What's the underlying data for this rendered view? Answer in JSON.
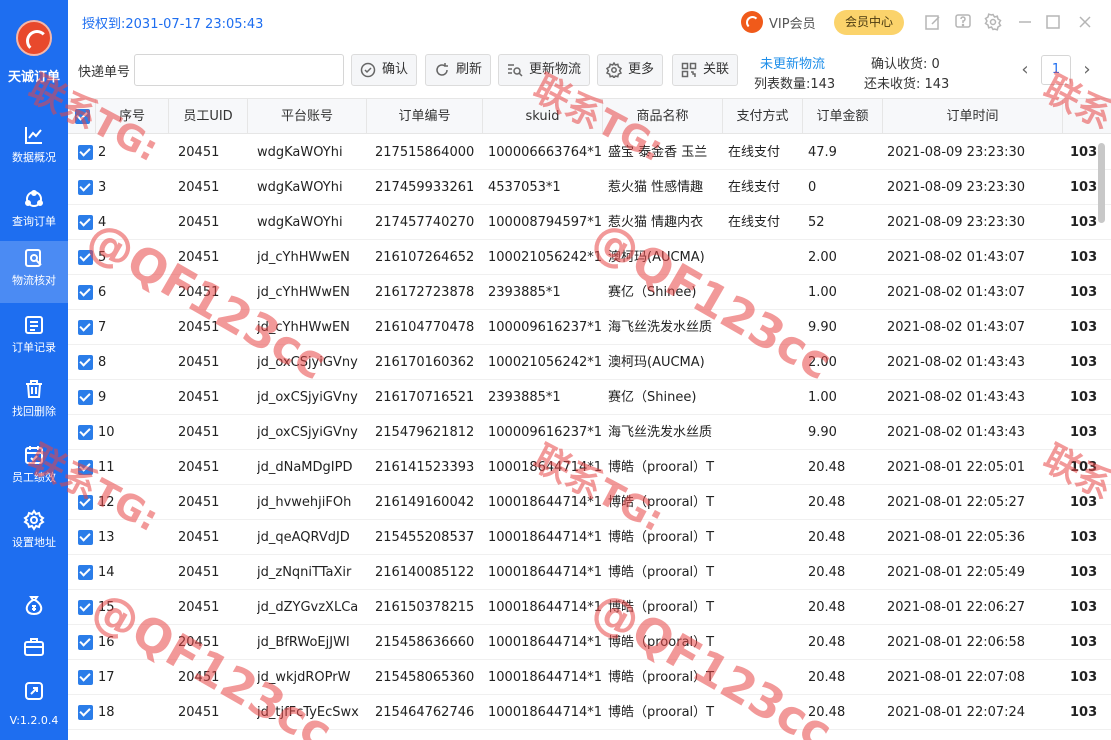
{
  "app": {
    "name": "天诚订单",
    "version": "V:1.2.0.4",
    "auth": "授权到:2031-07-17 23:05:43"
  },
  "sidebar": {
    "items": [
      {
        "label": "数据概况",
        "icon": "chart-line-icon",
        "active": false
      },
      {
        "label": "查询订单",
        "icon": "query-order-icon",
        "active": false
      },
      {
        "label": "物流核对",
        "icon": "logistics-check-icon",
        "active": true
      },
      {
        "label": "订单记录",
        "icon": "order-record-icon",
        "active": false
      },
      {
        "label": "找回删除",
        "icon": "trash-icon",
        "active": false
      },
      {
        "label": "员工绩效",
        "icon": "calendar-icon",
        "active": false
      },
      {
        "label": "设置地址",
        "icon": "gear-icon",
        "active": false
      }
    ],
    "extra_icons": [
      "money-bag-icon",
      "briefcase-icon",
      "share-icon"
    ]
  },
  "header": {
    "vip": "VIP会员",
    "member_center": "会员中心"
  },
  "toolbar": {
    "search_label": "快递单号",
    "search_value": "",
    "confirm": "确认",
    "refresh": "刷新",
    "update_logistics": "更新物流",
    "more": "更多",
    "related": "关联",
    "stats": {
      "not_updated": "未更新物流",
      "list_count": "列表数量:143",
      "confirmed": "确认收货:  0",
      "unconfirmed": "还未收货:  143"
    },
    "page": "1"
  },
  "table": {
    "columns": [
      "序号",
      "员工UID",
      "平台账号",
      "订单编号",
      "skuid",
      "商品名称",
      "支付方式",
      "订单金额",
      "订单时间"
    ],
    "rows": [
      {
        "no": "2",
        "uid": "20451",
        "account": "wdgKaWOYhi",
        "order": "217515864000",
        "skuid": "100006663764*1",
        "name": "盛宝 泰金香 玉兰",
        "pay": "在线支付",
        "amount": "47.9",
        "time": "2021-08-09 23:23:30",
        "extra": "103"
      },
      {
        "no": "3",
        "uid": "20451",
        "account": "wdgKaWOYhi",
        "order": "217459933261",
        "skuid": "4537053*1",
        "name": "惹火猫 性感情趣",
        "pay": "在线支付",
        "amount": "0",
        "time": "2021-08-09 23:23:30",
        "extra": "103"
      },
      {
        "no": "4",
        "uid": "20451",
        "account": "wdgKaWOYhi",
        "order": "217457740270",
        "skuid": "100008794597*1",
        "name": "惹火猫 情趣内衣",
        "pay": "在线支付",
        "amount": "52",
        "time": "2021-08-09 23:23:30",
        "extra": "103"
      },
      {
        "no": "5",
        "uid": "20451",
        "account": "jd_cYhHWwEN",
        "order": "216107264652",
        "skuid": "100021056242*1",
        "name": "澳柯玛(AUCMA)",
        "pay": "",
        "amount": "2.00",
        "time": "2021-08-02 01:43:07",
        "extra": "103"
      },
      {
        "no": "6",
        "uid": "20451",
        "account": "jd_cYhHWwEN",
        "order": "216172723878",
        "skuid": "2393885*1",
        "name": "赛亿（Shinee)",
        "pay": "",
        "amount": "1.00",
        "time": "2021-08-02 01:43:07",
        "extra": "103"
      },
      {
        "no": "7",
        "uid": "20451",
        "account": "jd_cYhHWwEN",
        "order": "216104770478",
        "skuid": "100009616237*1",
        "name": "海飞丝洗发水丝质",
        "pay": "",
        "amount": "9.90",
        "time": "2021-08-02 01:43:07",
        "extra": "103"
      },
      {
        "no": "8",
        "uid": "20451",
        "account": "jd_oxCSjyiGVny",
        "order": "216170160362",
        "skuid": "100021056242*1",
        "name": "澳柯玛(AUCMA)",
        "pay": "",
        "amount": "2.00",
        "time": "2021-08-02 01:43:43",
        "extra": "103"
      },
      {
        "no": "9",
        "uid": "20451",
        "account": "jd_oxCSjyiGVny",
        "order": "216170716521",
        "skuid": "2393885*1",
        "name": "赛亿（Shinee)",
        "pay": "",
        "amount": "1.00",
        "time": "2021-08-02 01:43:43",
        "extra": "103"
      },
      {
        "no": "10",
        "uid": "20451",
        "account": "jd_oxCSjyiGVny",
        "order": "215479621812",
        "skuid": "100009616237*1",
        "name": "海飞丝洗发水丝质",
        "pay": "",
        "amount": "9.90",
        "time": "2021-08-02 01:43:43",
        "extra": "103"
      },
      {
        "no": "11",
        "uid": "20451",
        "account": "jd_dNaMDgIPD",
        "order": "216141523393",
        "skuid": "100018644714*1",
        "name": "博皓（prooral）T",
        "pay": "",
        "amount": "20.48",
        "time": "2021-08-01 22:05:01",
        "extra": "103"
      },
      {
        "no": "12",
        "uid": "20451",
        "account": "jd_hvwehjiFOh",
        "order": "216149160042",
        "skuid": "100018644714*1",
        "name": "博皓（prooral）T",
        "pay": "",
        "amount": "20.48",
        "time": "2021-08-01 22:05:27",
        "extra": "103"
      },
      {
        "no": "13",
        "uid": "20451",
        "account": "jd_qeAQRVdJD",
        "order": "215455208537",
        "skuid": "100018644714*1",
        "name": "博皓（prooral）T",
        "pay": "",
        "amount": "20.48",
        "time": "2021-08-01 22:05:36",
        "extra": "103"
      },
      {
        "no": "14",
        "uid": "20451",
        "account": "jd_zNqniTTaXir",
        "order": "216140085122",
        "skuid": "100018644714*1",
        "name": "博皓（prooral）T",
        "pay": "",
        "amount": "20.48",
        "time": "2021-08-01 22:05:49",
        "extra": "103"
      },
      {
        "no": "15",
        "uid": "20451",
        "account": "jd_dZYGvzXLCa",
        "order": "216150378215",
        "skuid": "100018644714*1",
        "name": "博皓（prooral）T",
        "pay": "",
        "amount": "20.48",
        "time": "2021-08-01 22:06:27",
        "extra": "103"
      },
      {
        "no": "16",
        "uid": "20451",
        "account": "jd_BfRWoEjJWI",
        "order": "215458636660",
        "skuid": "100018644714*1",
        "name": "博皓（prooral）T",
        "pay": "",
        "amount": "20.48",
        "time": "2021-08-01 22:06:58",
        "extra": "103"
      },
      {
        "no": "17",
        "uid": "20451",
        "account": "jd_wkjdROPrW",
        "order": "215458065360",
        "skuid": "100018644714*1",
        "name": "博皓（prooral）T",
        "pay": "",
        "amount": "20.48",
        "time": "2021-08-01 22:07:08",
        "extra": "103"
      },
      {
        "no": "18",
        "uid": "20451",
        "account": "jd_tjfFcTyEcSwx",
        "order": "215464762746",
        "skuid": "100018644714*1",
        "name": "博皓（prooral）T",
        "pay": "",
        "amount": "20.48",
        "time": "2021-08-01 22:07:24",
        "extra": "103"
      }
    ]
  },
  "watermark": {
    "line1": "联系TG:",
    "line2": "@QF123cc"
  },
  "colors": {
    "sidebar": "#1e6ef0",
    "accent": "#1e8ee9",
    "checkbox": "#2b7de9",
    "watermark": "#e84646"
  }
}
